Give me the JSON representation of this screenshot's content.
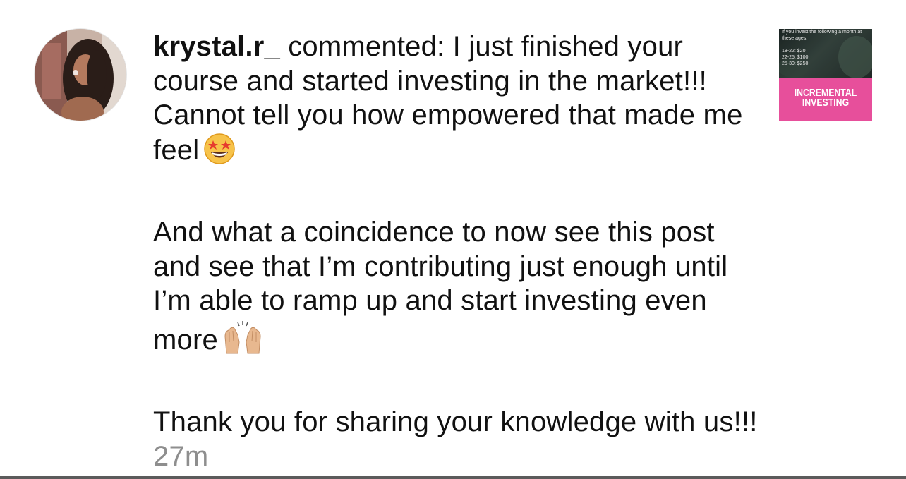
{
  "comment": {
    "username": "krystal.r_",
    "action": " commented: ",
    "paragraph1": "I just finished your course and started investing in the market!!! Cannot tell you how empowered that made me feel",
    "paragraph2": "And what a coincidence to now see this post and see that I’m contributing just enough until I’m able to ramp up and start investing even more",
    "paragraph3": "Thank you for sharing your knowledge with us!!!",
    "timestamp": "27m",
    "emoji1": "star-struck-emoji-icon",
    "emoji2": "raising-hands-emoji-icon"
  },
  "avatar": {
    "icon": "profile-photo-avatar"
  },
  "post_thumbnail": {
    "lines": "If you invest the following a month at\nthese ages:\n\n18-22: $20\n22-25: $100\n25-30: $250",
    "title_line1": "INCREMENTAL",
    "title_line2": "INVESTING",
    "banner_color": "#e74f9b"
  }
}
